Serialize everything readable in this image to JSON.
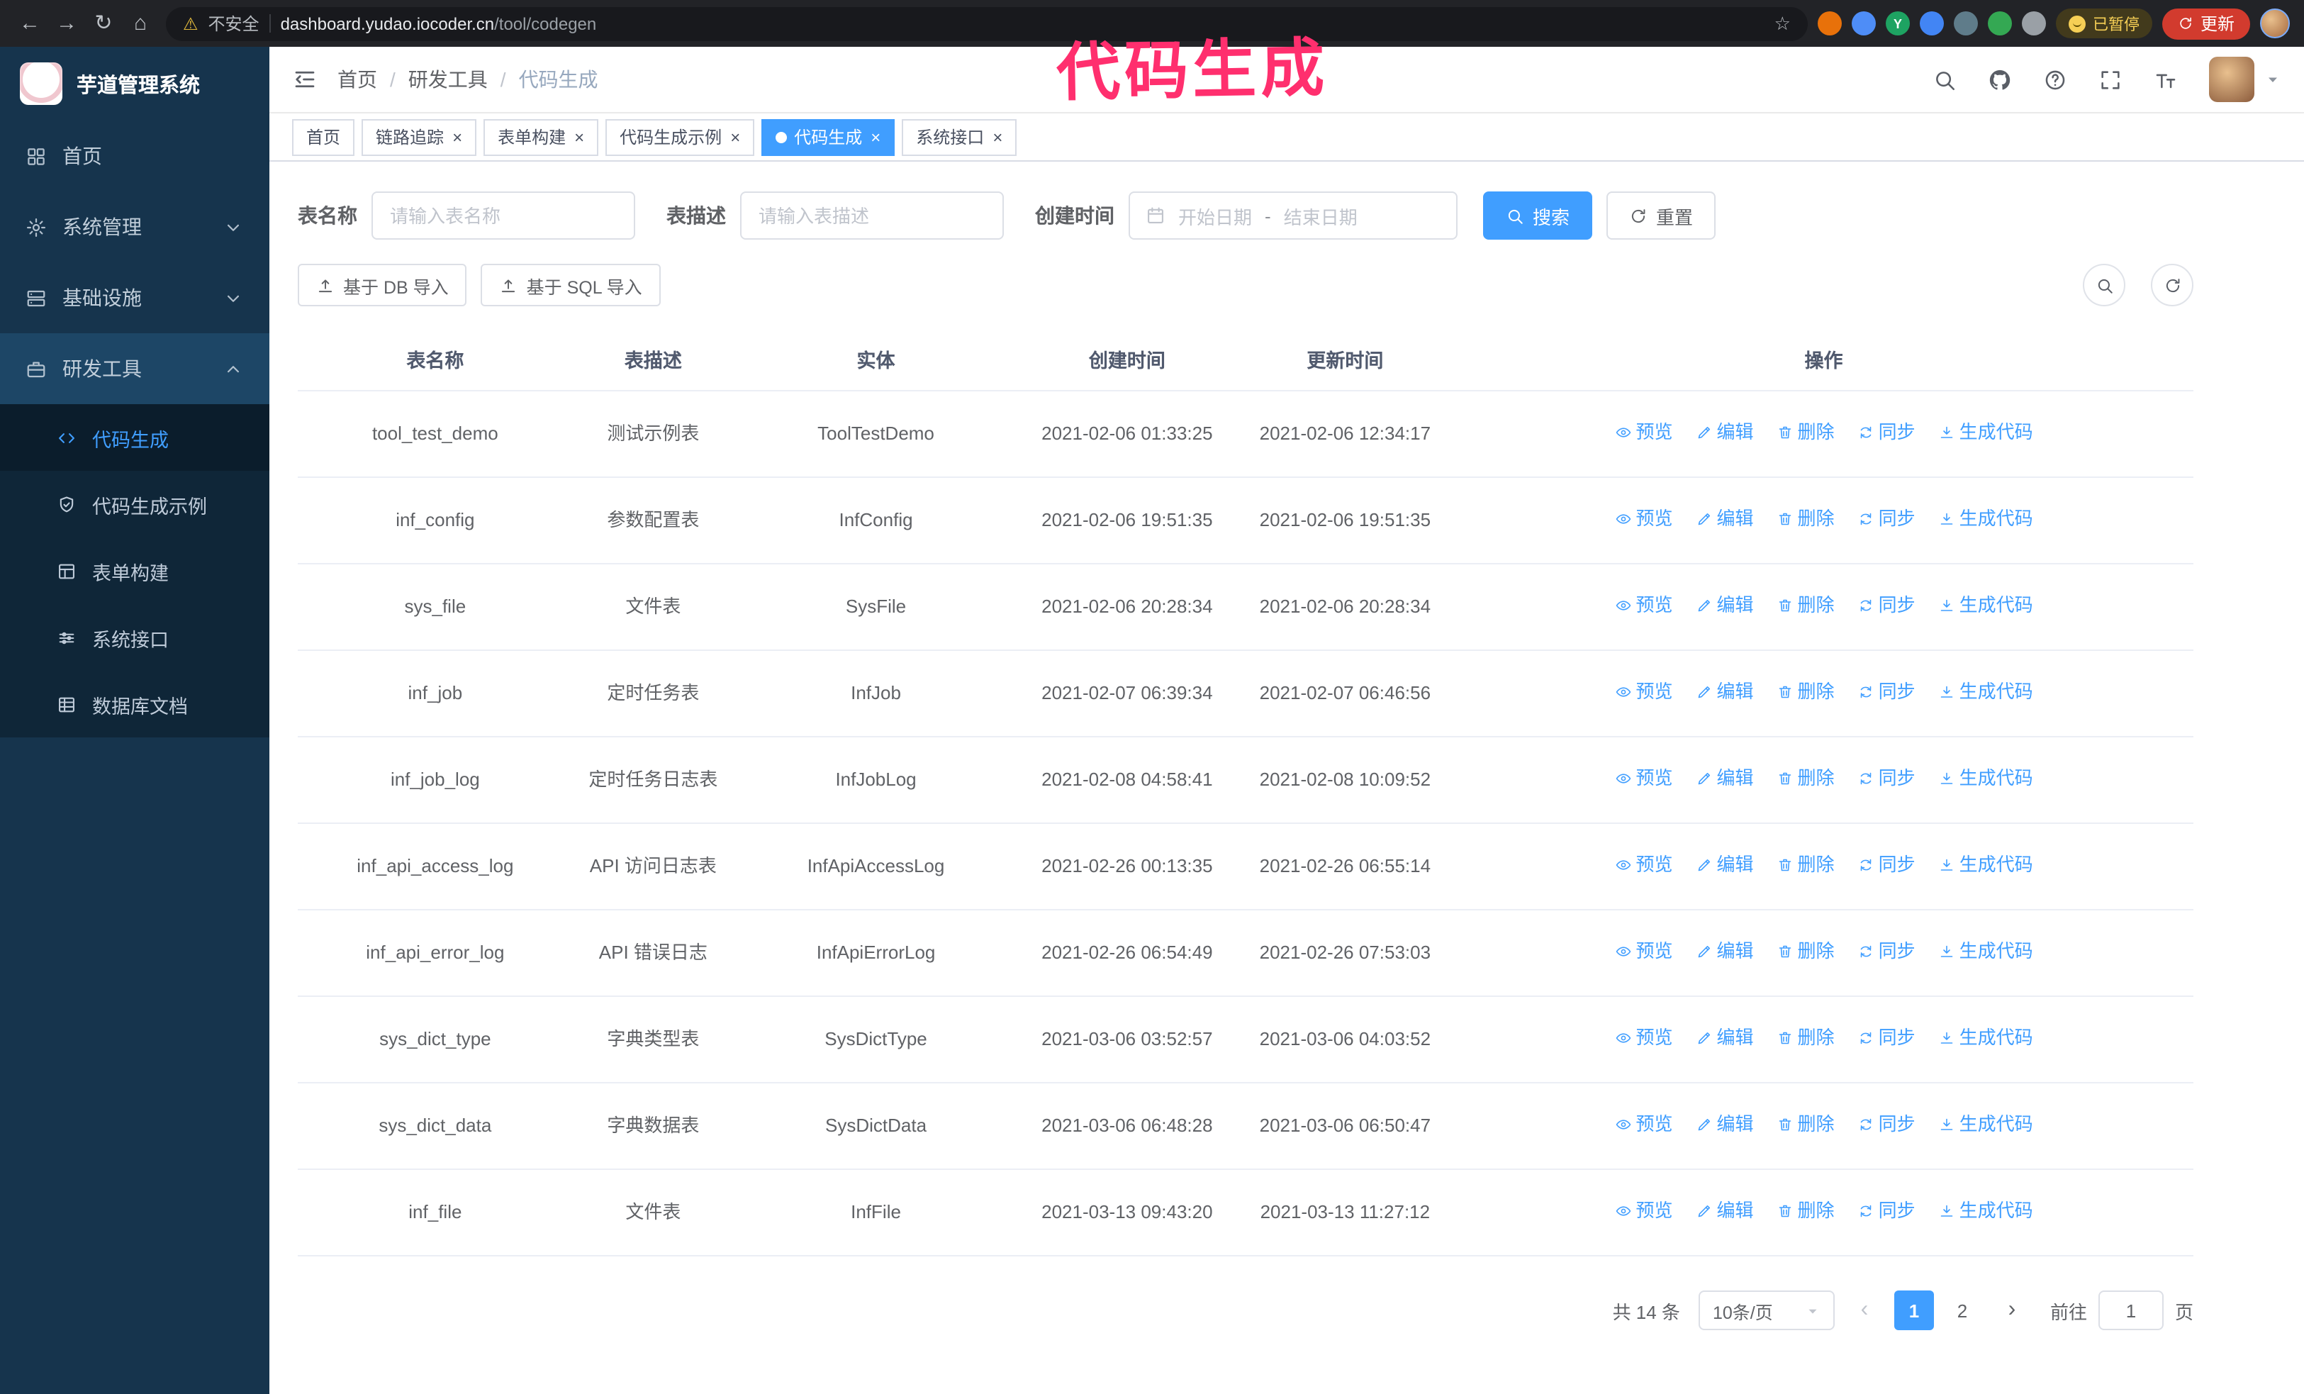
{
  "colors": {
    "accent": "#409eff",
    "annotation": "#ff2f6e",
    "sidebar_bg": "#16344d",
    "submenu_bg": "#0f2638"
  },
  "browser": {
    "nav_icons": [
      {
        "name": "back",
        "glyph": "←"
      },
      {
        "name": "forward",
        "glyph": "→"
      },
      {
        "name": "reload",
        "glyph": "↻"
      },
      {
        "name": "home",
        "glyph": "⌂"
      }
    ],
    "security_label": "不安全",
    "url_host": "dashboard.yudao.iocoder.cn",
    "url_path": "/tool/codegen",
    "extensions": [
      {
        "name": "extension-icon-orange",
        "color": "#e8710a"
      },
      {
        "name": "extension-icon-blue-drop",
        "color": "#4e8df7"
      },
      {
        "name": "extension-icon-green-y",
        "color": "#1ea362",
        "letter": "Y"
      },
      {
        "name": "extension-icon-people",
        "color": "#4285f4"
      },
      {
        "name": "extension-icon-gray",
        "color": "#5f7c8a"
      },
      {
        "name": "extension-icon-green",
        "color": "#34a853"
      },
      {
        "name": "extension-icon-puzzle",
        "color": "#9aa0a6"
      }
    ],
    "paused_badge": "已暂停",
    "update_button": "更新"
  },
  "annotation": {
    "text": "代码生成"
  },
  "sidebar": {
    "logo_title": "芋道管理系统",
    "items": [
      {
        "label": "首页",
        "icon": "home-icon"
      },
      {
        "label": "系统管理",
        "icon": "gear-icon",
        "chevron": "down"
      },
      {
        "label": "基础设施",
        "icon": "server-icon",
        "chevron": "down"
      },
      {
        "label": "研发工具",
        "icon": "toolbox-icon",
        "chevron": "up",
        "selected": true
      }
    ],
    "submenu": [
      {
        "label": "代码生成",
        "icon": "code-icon",
        "active": true
      },
      {
        "label": "代码生成示例",
        "icon": "shield-icon"
      },
      {
        "label": "表单构建",
        "icon": "form-icon"
      },
      {
        "label": "系统接口",
        "icon": "api-icon"
      },
      {
        "label": "数据库文档",
        "icon": "database-icon"
      }
    ]
  },
  "breadcrumb": [
    "首页",
    "研发工具",
    "代码生成"
  ],
  "header": {
    "icons": [
      "search-icon",
      "github-icon",
      "question-icon",
      "fullscreen-icon",
      "font-size-icon"
    ]
  },
  "tabs": [
    {
      "label": "首页",
      "closable": false,
      "active": false
    },
    {
      "label": "链路追踪",
      "closable": true,
      "active": false
    },
    {
      "label": "表单构建",
      "closable": true,
      "active": false
    },
    {
      "label": "代码生成示例",
      "closable": true,
      "active": false
    },
    {
      "label": "代码生成",
      "closable": true,
      "active": true
    },
    {
      "label": "系统接口",
      "closable": true,
      "active": false
    }
  ],
  "filters": {
    "table_name_label": "表名称",
    "table_name_placeholder": "请输入表名称",
    "table_desc_label": "表描述",
    "table_desc_placeholder": "请输入表描述",
    "create_time_label": "创建时间",
    "date_start_placeholder": "开始日期",
    "date_separator": "-",
    "date_end_placeholder": "结束日期",
    "search_button": "搜索",
    "reset_button": "重置"
  },
  "toolbar": {
    "import_db_button": "基于 DB 导入",
    "import_sql_button": "基于 SQL 导入"
  },
  "table": {
    "columns": [
      "表名称",
      "表描述",
      "实体",
      "创建时间",
      "更新时间",
      "操作"
    ],
    "actions": [
      {
        "label": "预览",
        "icon": "eye-icon"
      },
      {
        "label": "编辑",
        "icon": "edit-icon"
      },
      {
        "label": "删除",
        "icon": "trash-icon"
      },
      {
        "label": "同步",
        "icon": "sync-icon"
      },
      {
        "label": "生成代码",
        "icon": "download-icon"
      }
    ],
    "rows": [
      {
        "name": "tool_test_demo",
        "desc": "测试示例表",
        "entity": "ToolTestDemo",
        "created": "2021-02-06 01:33:25",
        "updated": "2021-02-06 12:34:17"
      },
      {
        "name": "inf_config",
        "desc": "参数配置表",
        "entity": "InfConfig",
        "created": "2021-02-06 19:51:35",
        "updated": "2021-02-06 19:51:35"
      },
      {
        "name": "sys_file",
        "desc": "文件表",
        "entity": "SysFile",
        "created": "2021-02-06 20:28:34",
        "updated": "2021-02-06 20:28:34"
      },
      {
        "name": "inf_job",
        "desc": "定时任务表",
        "entity": "InfJob",
        "created": "2021-02-07 06:39:34",
        "updated": "2021-02-07 06:46:56"
      },
      {
        "name": "inf_job_log",
        "desc": "定时任务日志表",
        "entity": "InfJobLog",
        "created": "2021-02-08 04:58:41",
        "updated": "2021-02-08 10:09:52"
      },
      {
        "name": "inf_api_access_log",
        "desc": "API 访问日志表",
        "entity": "InfApiAccessLog",
        "created": "2021-02-26 00:13:35",
        "updated": "2021-02-26 06:55:14"
      },
      {
        "name": "inf_api_error_log",
        "desc": "API 错误日志",
        "entity": "InfApiErrorLog",
        "created": "2021-02-26 06:54:49",
        "updated": "2021-02-26 07:53:03"
      },
      {
        "name": "sys_dict_type",
        "desc": "字典类型表",
        "entity": "SysDictType",
        "created": "2021-03-06 03:52:57",
        "updated": "2021-03-06 04:03:52"
      },
      {
        "name": "sys_dict_data",
        "desc": "字典数据表",
        "entity": "SysDictData",
        "created": "2021-03-06 06:48:28",
        "updated": "2021-03-06 06:50:47"
      },
      {
        "name": "inf_file",
        "desc": "文件表",
        "entity": "InfFile",
        "created": "2021-03-13 09:43:20",
        "updated": "2021-03-13 11:27:12"
      }
    ]
  },
  "pagination": {
    "total": "共 14 条",
    "page_size": "10条/页",
    "prev": "‹",
    "next": "›",
    "pages": [
      "1",
      "2"
    ],
    "active_page": "1",
    "goto_label": "前往",
    "goto_value": "1",
    "goto_suffix": "页"
  }
}
